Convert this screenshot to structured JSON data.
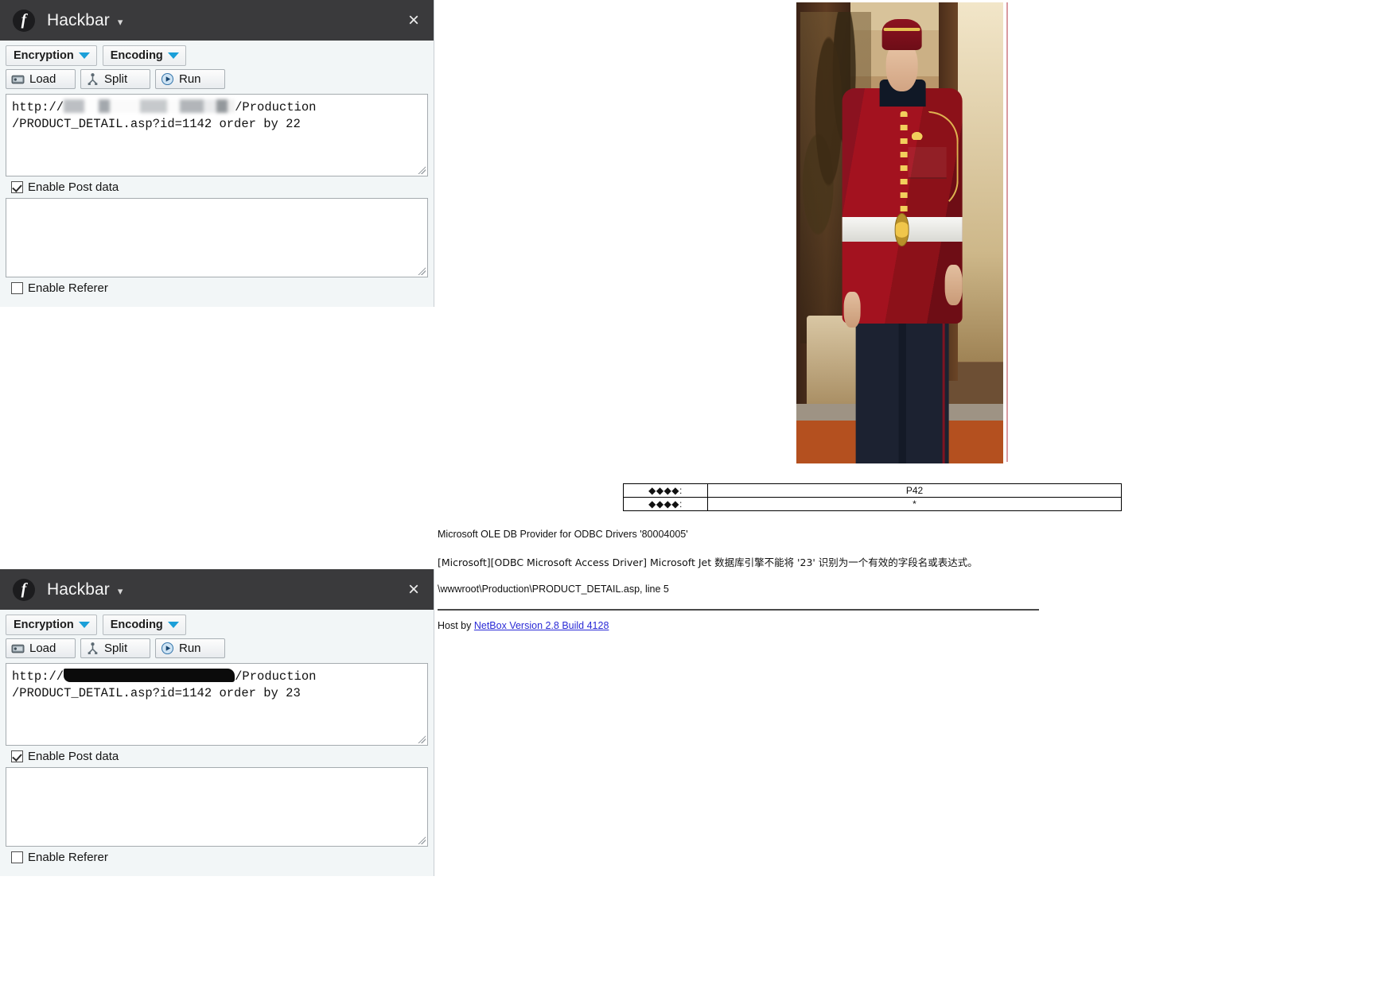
{
  "panels": [
    {
      "title": "Hackbar",
      "caret": "chevron-down",
      "close": "×",
      "dropdowns": [
        {
          "label": "Encryption"
        },
        {
          "label": "Encoding"
        }
      ],
      "actions": [
        {
          "label": "Load",
          "icon": "load-icon"
        },
        {
          "label": "Split",
          "icon": "split-icon"
        },
        {
          "label": "Run",
          "icon": "run-icon"
        }
      ],
      "url": {
        "prefix": "http://",
        "redaction": "blur",
        "suffix": "/Production\n/PRODUCT_DETAIL.asp?id=1142 order by 22"
      },
      "post_checkbox": {
        "label": "Enable Post data",
        "checked": true
      },
      "post_value": "",
      "referer_checkbox": {
        "label": "Enable Referer",
        "checked": false
      }
    },
    {
      "title": "Hackbar",
      "caret": "chevron-down",
      "close": "×",
      "dropdowns": [
        {
          "label": "Encryption"
        },
        {
          "label": "Encoding"
        }
      ],
      "actions": [
        {
          "label": "Load",
          "icon": "load-icon"
        },
        {
          "label": "Split",
          "icon": "split-icon"
        },
        {
          "label": "Run",
          "icon": "run-icon"
        }
      ],
      "url": {
        "prefix": "http://",
        "redaction": "black",
        "suffix": "/Production\n/PRODUCT_DETAIL.asp?id=1142 order by 23"
      },
      "post_checkbox": {
        "label": "Enable Post data",
        "checked": true
      },
      "post_value": "",
      "referer_checkbox": {
        "label": "Enable Referer",
        "checked": false
      }
    }
  ],
  "page": {
    "product_image_alt": "man in red ceremonial doorman uniform",
    "spec_table": {
      "rows": [
        {
          "label": "◆◆◆◆:",
          "value": "P42"
        },
        {
          "label": "◆◆◆◆:",
          "value": "*"
        }
      ]
    },
    "error": {
      "line1": "Microsoft OLE DB Provider for ODBC Drivers '80004005'",
      "line2": "[Microsoft][ODBC Microsoft Access Driver] Microsoft Jet 数据库引擎不能将 '23' 识别为一个有效的字段名或表达式。",
      "line3": "\\wwwroot\\Production\\PRODUCT_DETAIL.asp, line 5"
    },
    "footer": {
      "prefix": "Host by ",
      "link": "NetBox Version 2.8 Build 4128"
    }
  },
  "colors": {
    "titlebar": "#3a3a3c",
    "panel": "#f2f6f7",
    "accent": "#1b9fd8",
    "link": "#2a2ad6",
    "uniform_red": "#a3121f"
  }
}
